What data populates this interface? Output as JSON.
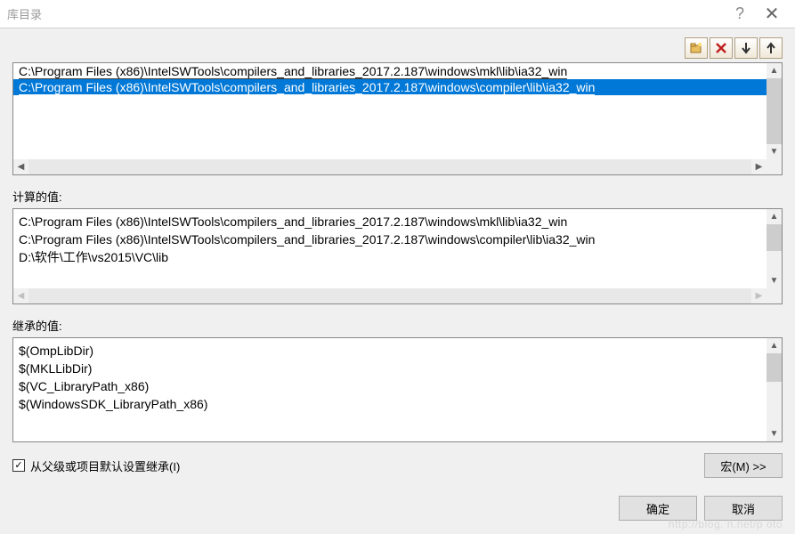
{
  "window": {
    "title": "库目录",
    "help_icon": "?",
    "close_icon": "✕"
  },
  "toolbar": {
    "new_folder": "new-folder",
    "delete": "delete",
    "move_down": "↓",
    "move_up": "↑"
  },
  "directories": {
    "items": [
      {
        "text": "C:\\Program Files (x86)\\IntelSWTools\\compilers_and_libraries_2017.2.187\\windows\\mkl\\lib\\ia32_win",
        "selected": false
      },
      {
        "text": "C:\\Program Files (x86)\\IntelSWTools\\compilers_and_libraries_2017.2.187\\windows\\compiler\\lib\\ia32_win",
        "selected": true
      }
    ]
  },
  "evaluated": {
    "label": "计算的值:",
    "items": [
      "C:\\Program Files (x86)\\IntelSWTools\\compilers_and_libraries_2017.2.187\\windows\\mkl\\lib\\ia32_win",
      "C:\\Program Files (x86)\\IntelSWTools\\compilers_and_libraries_2017.2.187\\windows\\compiler\\lib\\ia32_win",
      "D:\\软件\\工作\\vs2015\\VC\\lib"
    ]
  },
  "inherited": {
    "label": "继承的值:",
    "items": [
      "$(OmpLibDir)",
      "$(MKLLibDir)",
      "$(VC_LibraryPath_x86)",
      "$(WindowsSDK_LibraryPath_x86)"
    ]
  },
  "inherit_checkbox": {
    "label": "从父级或项目默认设置继承(I)",
    "checked": true,
    "mark": "✓"
  },
  "buttons": {
    "macros": "宏(M) >>",
    "ok": "确定",
    "cancel": "取消"
  },
  "watermark": "http://blog.    n.net/p   oto"
}
